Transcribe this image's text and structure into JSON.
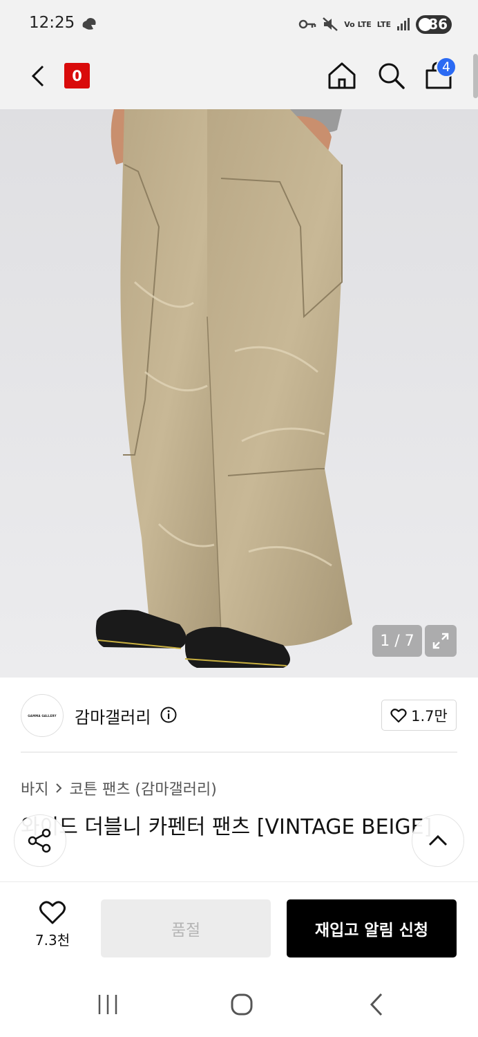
{
  "status_bar": {
    "time": "12:25",
    "battery": "86",
    "network_label": "LTE",
    "volte_label": "Vo LTE"
  },
  "nav": {
    "logo_text": "0",
    "cart_count": "4"
  },
  "gallery": {
    "counter": "1 / 7"
  },
  "brand": {
    "avatar_text": "GAMMA GALLERY",
    "name": "감마갤러리",
    "likes": "1.7만"
  },
  "breadcrumb": {
    "category": "바지",
    "subcategory": "코튼 팬츠 (감마갤러리)"
  },
  "product": {
    "title": "와이드 더블니 카펜터 팬츠 [VINTAGE BEIGE]"
  },
  "actions": {
    "wish_count": "7.3천",
    "soldout_label": "품절",
    "restock_label": "재입고 알림 신청"
  },
  "icons": {
    "back": "chevron-left-icon",
    "home": "home-icon",
    "search": "search-icon",
    "cart": "shopping-bag-icon",
    "expand": "expand-icon",
    "info": "info-icon",
    "heart": "heart-icon",
    "share": "share-icon",
    "scroll_top": "chevron-up-icon"
  },
  "colors": {
    "brand_red": "#d90b0b",
    "badge_blue": "#2b6af3",
    "primary_button": "#000000",
    "disabled_button": "#ececec"
  }
}
